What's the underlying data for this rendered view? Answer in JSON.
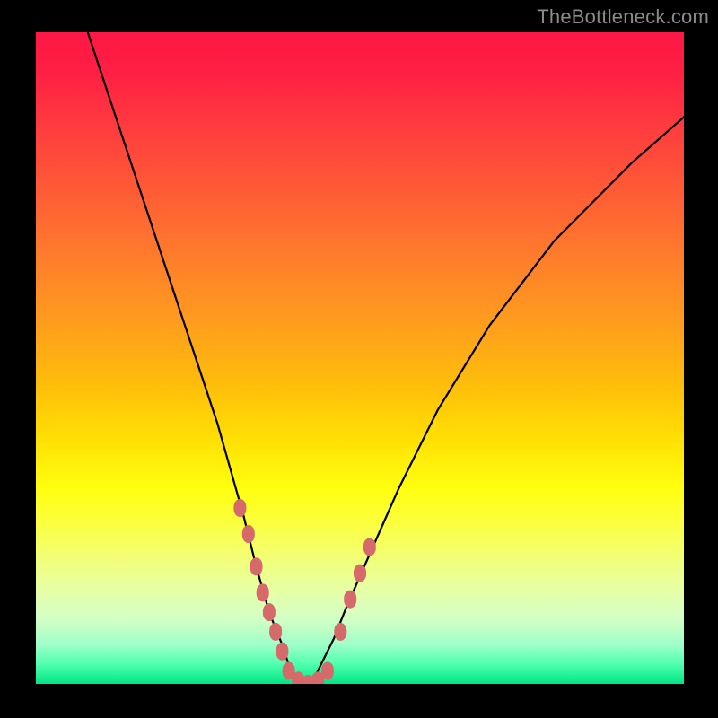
{
  "watermark": "TheBottleneck.com",
  "colors": {
    "page_bg": "#000000",
    "curve": "#000000",
    "markers": "#d66a6a",
    "gradient_top": "#ff1745",
    "gradient_bottom": "#00e585"
  },
  "chart_data": {
    "type": "line",
    "title": "",
    "xlabel": "",
    "ylabel": "",
    "xlim": [
      0,
      100
    ],
    "ylim": [
      0,
      100
    ],
    "axes_visible": false,
    "grid": false,
    "background": "vertical-rainbow-gradient",
    "series": [
      {
        "name": "bottleneck-curve",
        "x": [
          8,
          12,
          16,
          20,
          24,
          28,
          32,
          34,
          36,
          38,
          39,
          40,
          41,
          42,
          43,
          44,
          46,
          48,
          52,
          56,
          62,
          70,
          80,
          92,
          100
        ],
        "y": [
          100,
          88,
          76,
          64,
          52,
          40,
          26,
          18,
          11,
          6,
          3,
          1,
          0,
          0,
          1,
          3,
          7,
          12,
          21,
          30,
          42,
          55,
          68,
          80,
          87
        ]
      }
    ],
    "markers": [
      {
        "name": "left-cluster",
        "points": [
          {
            "x": 31.5,
            "y": 27
          },
          {
            "x": 32.8,
            "y": 23
          },
          {
            "x": 34.0,
            "y": 18
          },
          {
            "x": 35.0,
            "y": 14
          },
          {
            "x": 36.0,
            "y": 11
          },
          {
            "x": 37.0,
            "y": 8
          },
          {
            "x": 38.0,
            "y": 5
          }
        ]
      },
      {
        "name": "valley-cluster",
        "points": [
          {
            "x": 39.0,
            "y": 2
          },
          {
            "x": 40.5,
            "y": 0.5
          },
          {
            "x": 42.0,
            "y": 0
          },
          {
            "x": 43.5,
            "y": 0.5
          },
          {
            "x": 45.0,
            "y": 2
          }
        ]
      },
      {
        "name": "right-cluster",
        "points": [
          {
            "x": 47.0,
            "y": 8
          },
          {
            "x": 48.5,
            "y": 13
          },
          {
            "x": 50.0,
            "y": 17
          },
          {
            "x": 51.5,
            "y": 21
          }
        ]
      }
    ]
  }
}
